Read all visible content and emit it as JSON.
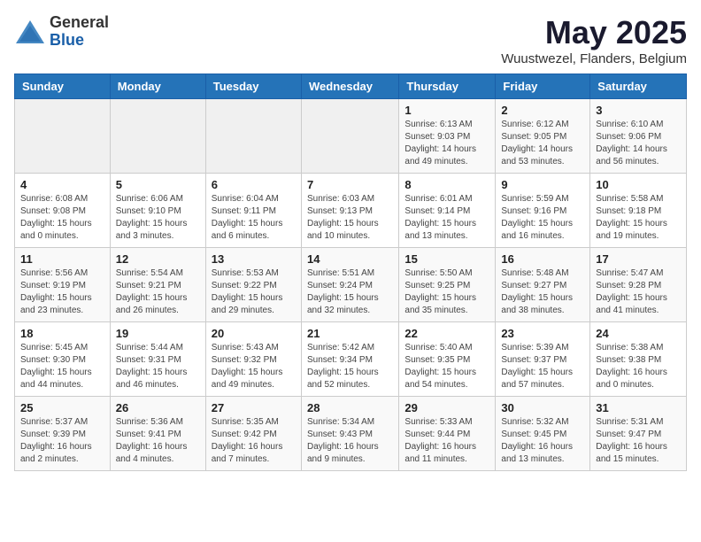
{
  "logo": {
    "general": "General",
    "blue": "Blue"
  },
  "header": {
    "title": "May 2025",
    "subtitle": "Wuustwezel, Flanders, Belgium"
  },
  "days_of_week": [
    "Sunday",
    "Monday",
    "Tuesday",
    "Wednesday",
    "Thursday",
    "Friday",
    "Saturday"
  ],
  "weeks": [
    [
      {
        "num": "",
        "detail": ""
      },
      {
        "num": "",
        "detail": ""
      },
      {
        "num": "",
        "detail": ""
      },
      {
        "num": "",
        "detail": ""
      },
      {
        "num": "1",
        "detail": "Sunrise: 6:13 AM\nSunset: 9:03 PM\nDaylight: 14 hours\nand 49 minutes."
      },
      {
        "num": "2",
        "detail": "Sunrise: 6:12 AM\nSunset: 9:05 PM\nDaylight: 14 hours\nand 53 minutes."
      },
      {
        "num": "3",
        "detail": "Sunrise: 6:10 AM\nSunset: 9:06 PM\nDaylight: 14 hours\nand 56 minutes."
      }
    ],
    [
      {
        "num": "4",
        "detail": "Sunrise: 6:08 AM\nSunset: 9:08 PM\nDaylight: 15 hours\nand 0 minutes."
      },
      {
        "num": "5",
        "detail": "Sunrise: 6:06 AM\nSunset: 9:10 PM\nDaylight: 15 hours\nand 3 minutes."
      },
      {
        "num": "6",
        "detail": "Sunrise: 6:04 AM\nSunset: 9:11 PM\nDaylight: 15 hours\nand 6 minutes."
      },
      {
        "num": "7",
        "detail": "Sunrise: 6:03 AM\nSunset: 9:13 PM\nDaylight: 15 hours\nand 10 minutes."
      },
      {
        "num": "8",
        "detail": "Sunrise: 6:01 AM\nSunset: 9:14 PM\nDaylight: 15 hours\nand 13 minutes."
      },
      {
        "num": "9",
        "detail": "Sunrise: 5:59 AM\nSunset: 9:16 PM\nDaylight: 15 hours\nand 16 minutes."
      },
      {
        "num": "10",
        "detail": "Sunrise: 5:58 AM\nSunset: 9:18 PM\nDaylight: 15 hours\nand 19 minutes."
      }
    ],
    [
      {
        "num": "11",
        "detail": "Sunrise: 5:56 AM\nSunset: 9:19 PM\nDaylight: 15 hours\nand 23 minutes."
      },
      {
        "num": "12",
        "detail": "Sunrise: 5:54 AM\nSunset: 9:21 PM\nDaylight: 15 hours\nand 26 minutes."
      },
      {
        "num": "13",
        "detail": "Sunrise: 5:53 AM\nSunset: 9:22 PM\nDaylight: 15 hours\nand 29 minutes."
      },
      {
        "num": "14",
        "detail": "Sunrise: 5:51 AM\nSunset: 9:24 PM\nDaylight: 15 hours\nand 32 minutes."
      },
      {
        "num": "15",
        "detail": "Sunrise: 5:50 AM\nSunset: 9:25 PM\nDaylight: 15 hours\nand 35 minutes."
      },
      {
        "num": "16",
        "detail": "Sunrise: 5:48 AM\nSunset: 9:27 PM\nDaylight: 15 hours\nand 38 minutes."
      },
      {
        "num": "17",
        "detail": "Sunrise: 5:47 AM\nSunset: 9:28 PM\nDaylight: 15 hours\nand 41 minutes."
      }
    ],
    [
      {
        "num": "18",
        "detail": "Sunrise: 5:45 AM\nSunset: 9:30 PM\nDaylight: 15 hours\nand 44 minutes."
      },
      {
        "num": "19",
        "detail": "Sunrise: 5:44 AM\nSunset: 9:31 PM\nDaylight: 15 hours\nand 46 minutes."
      },
      {
        "num": "20",
        "detail": "Sunrise: 5:43 AM\nSunset: 9:32 PM\nDaylight: 15 hours\nand 49 minutes."
      },
      {
        "num": "21",
        "detail": "Sunrise: 5:42 AM\nSunset: 9:34 PM\nDaylight: 15 hours\nand 52 minutes."
      },
      {
        "num": "22",
        "detail": "Sunrise: 5:40 AM\nSunset: 9:35 PM\nDaylight: 15 hours\nand 54 minutes."
      },
      {
        "num": "23",
        "detail": "Sunrise: 5:39 AM\nSunset: 9:37 PM\nDaylight: 15 hours\nand 57 minutes."
      },
      {
        "num": "24",
        "detail": "Sunrise: 5:38 AM\nSunset: 9:38 PM\nDaylight: 16 hours\nand 0 minutes."
      }
    ],
    [
      {
        "num": "25",
        "detail": "Sunrise: 5:37 AM\nSunset: 9:39 PM\nDaylight: 16 hours\nand 2 minutes."
      },
      {
        "num": "26",
        "detail": "Sunrise: 5:36 AM\nSunset: 9:41 PM\nDaylight: 16 hours\nand 4 minutes."
      },
      {
        "num": "27",
        "detail": "Sunrise: 5:35 AM\nSunset: 9:42 PM\nDaylight: 16 hours\nand 7 minutes."
      },
      {
        "num": "28",
        "detail": "Sunrise: 5:34 AM\nSunset: 9:43 PM\nDaylight: 16 hours\nand 9 minutes."
      },
      {
        "num": "29",
        "detail": "Sunrise: 5:33 AM\nSunset: 9:44 PM\nDaylight: 16 hours\nand 11 minutes."
      },
      {
        "num": "30",
        "detail": "Sunrise: 5:32 AM\nSunset: 9:45 PM\nDaylight: 16 hours\nand 13 minutes."
      },
      {
        "num": "31",
        "detail": "Sunrise: 5:31 AM\nSunset: 9:47 PM\nDaylight: 16 hours\nand 15 minutes."
      }
    ]
  ]
}
